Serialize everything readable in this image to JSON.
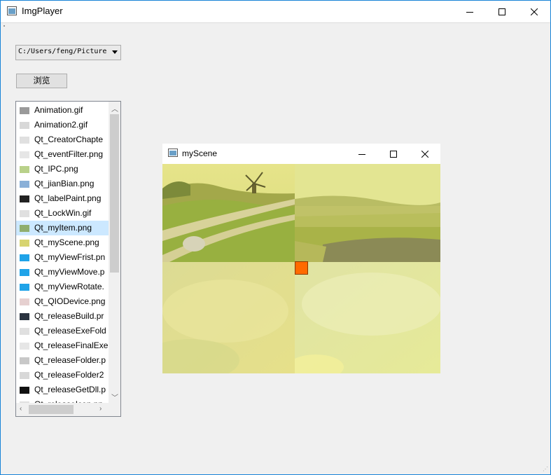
{
  "window": {
    "title": "ImgPlayer"
  },
  "path_combo": {
    "value": "C:/Users/feng/Picture"
  },
  "browse_button": {
    "label": "浏览"
  },
  "file_list": {
    "selected_index": 8,
    "items": [
      {
        "label": "Animation.gif",
        "icon": "gray-square-thumb",
        "color": "#9a9a9a"
      },
      {
        "label": "Animation2.gif",
        "icon": "light-thumb",
        "color": "#d8d8d8"
      },
      {
        "label": "Qt_CreatorChapte",
        "icon": "light-thumb",
        "color": "#e0e0e0"
      },
      {
        "label": "Qt_eventFilter.png",
        "icon": "light-thumb",
        "color": "#e6e6e6"
      },
      {
        "label": "Qt_IPC.png",
        "icon": "green-thumb",
        "color": "#b9d18a"
      },
      {
        "label": "Qt_jianBian.png",
        "icon": "colorful-thumb",
        "color": "#8ab0d8"
      },
      {
        "label": "Qt_labelPaint.png",
        "icon": "black-dot-thumb",
        "color": "#222222"
      },
      {
        "label": "Qt_LockWin.gif",
        "icon": "light-thumb",
        "color": "#e0e0e0"
      },
      {
        "label": "Qt_myItem.png",
        "icon": "landscape-thumb",
        "color": "#8fae6e"
      },
      {
        "label": "Qt_myScene.png",
        "icon": "yellow-thumb",
        "color": "#d7d470"
      },
      {
        "label": "Qt_myViewFrist.pn",
        "icon": "blue-thumb",
        "color": "#1fa3e8"
      },
      {
        "label": "Qt_myViewMove.p",
        "icon": "blue-thumb",
        "color": "#1fa3e8"
      },
      {
        "label": "Qt_myViewRotate.",
        "icon": "blue-thumb",
        "color": "#1fa3e8"
      },
      {
        "label": "Qt_QIODevice.png",
        "icon": "light-thumb",
        "color": "#e6d0d0"
      },
      {
        "label": "Qt_releaseBuild.pr",
        "icon": "dark-thumb",
        "color": "#2b3340"
      },
      {
        "label": "Qt_releaseExeFold",
        "icon": "light-thumb",
        "color": "#e0e0e0"
      },
      {
        "label": "Qt_releaseFinalExe",
        "icon": "light-thumb",
        "color": "#e6e6e6"
      },
      {
        "label": "Qt_releaseFolder.p",
        "icon": "line-thumb",
        "color": "#c8c8c8"
      },
      {
        "label": "Qt_releaseFolder2",
        "icon": "light-thumb",
        "color": "#d8d8d8"
      },
      {
        "label": "Qt_releaseGetDll.p",
        "icon": "black-thumb",
        "color": "#111111"
      },
      {
        "label": "Qt_releaseIcon.pn",
        "icon": "light-thumb",
        "color": "#e0e0e0"
      }
    ]
  },
  "child_window": {
    "title": "myScene"
  },
  "colors": {
    "accent_border": "#1883d7",
    "selection": "#cce8ff",
    "marker": "#ff6a00"
  }
}
